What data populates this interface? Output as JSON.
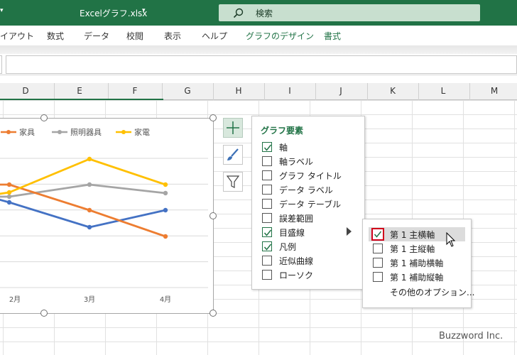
{
  "titlebar": {
    "left_caret": "▾",
    "filename": "Excelグラフ.xlsx",
    "caret": "▾",
    "search_placeholder": "検索"
  },
  "ribbon": {
    "tabs": [
      "イアウト",
      "数式",
      "データ",
      "校閲",
      "表示",
      "ヘルプ",
      "グラフのデザイン",
      "書式"
    ]
  },
  "columns": [
    "D",
    "E",
    "F",
    "G",
    "H",
    "I",
    "J",
    "K",
    "L",
    "M"
  ],
  "chart_data": {
    "type": "line",
    "categories": [
      "2月",
      "3月",
      "4月"
    ],
    "legend": [
      "家具",
      "照明器具",
      "家電"
    ],
    "series": [
      {
        "name": "",
        "color": "#4472c4"
      },
      {
        "name": "家具",
        "color": "#ed7d31"
      },
      {
        "name": "照明器具",
        "color": "#a5a5a5"
      },
      {
        "name": "家電",
        "color": "#ffc000"
      }
    ]
  },
  "panel": {
    "title": "グラフ要素",
    "items": [
      {
        "label": "軸",
        "checked": true
      },
      {
        "label": "軸ラベル",
        "checked": false
      },
      {
        "label": "グラフ タイトル",
        "checked": false
      },
      {
        "label": "データ ラベル",
        "checked": false
      },
      {
        "label": "データ テーブル",
        "checked": false
      },
      {
        "label": "誤差範囲",
        "checked": false
      },
      {
        "label": "目盛線",
        "checked": true
      },
      {
        "label": "凡例",
        "checked": true
      },
      {
        "label": "近似曲線",
        "checked": false
      },
      {
        "label": "ローソク",
        "checked": false
      }
    ]
  },
  "submenu": {
    "items": [
      {
        "label": "第 1 主横軸",
        "checked": true
      },
      {
        "label": "第 1 主縦軸",
        "checked": false
      },
      {
        "label": "第 1 補助横軸",
        "checked": false
      },
      {
        "label": "第 1 補助縦軸",
        "checked": false
      }
    ],
    "more": "その他のオプション..."
  },
  "brand": "Buzzword Inc.",
  "colors": {
    "accent": "#217346",
    "highlight_border": "#d0021b"
  }
}
